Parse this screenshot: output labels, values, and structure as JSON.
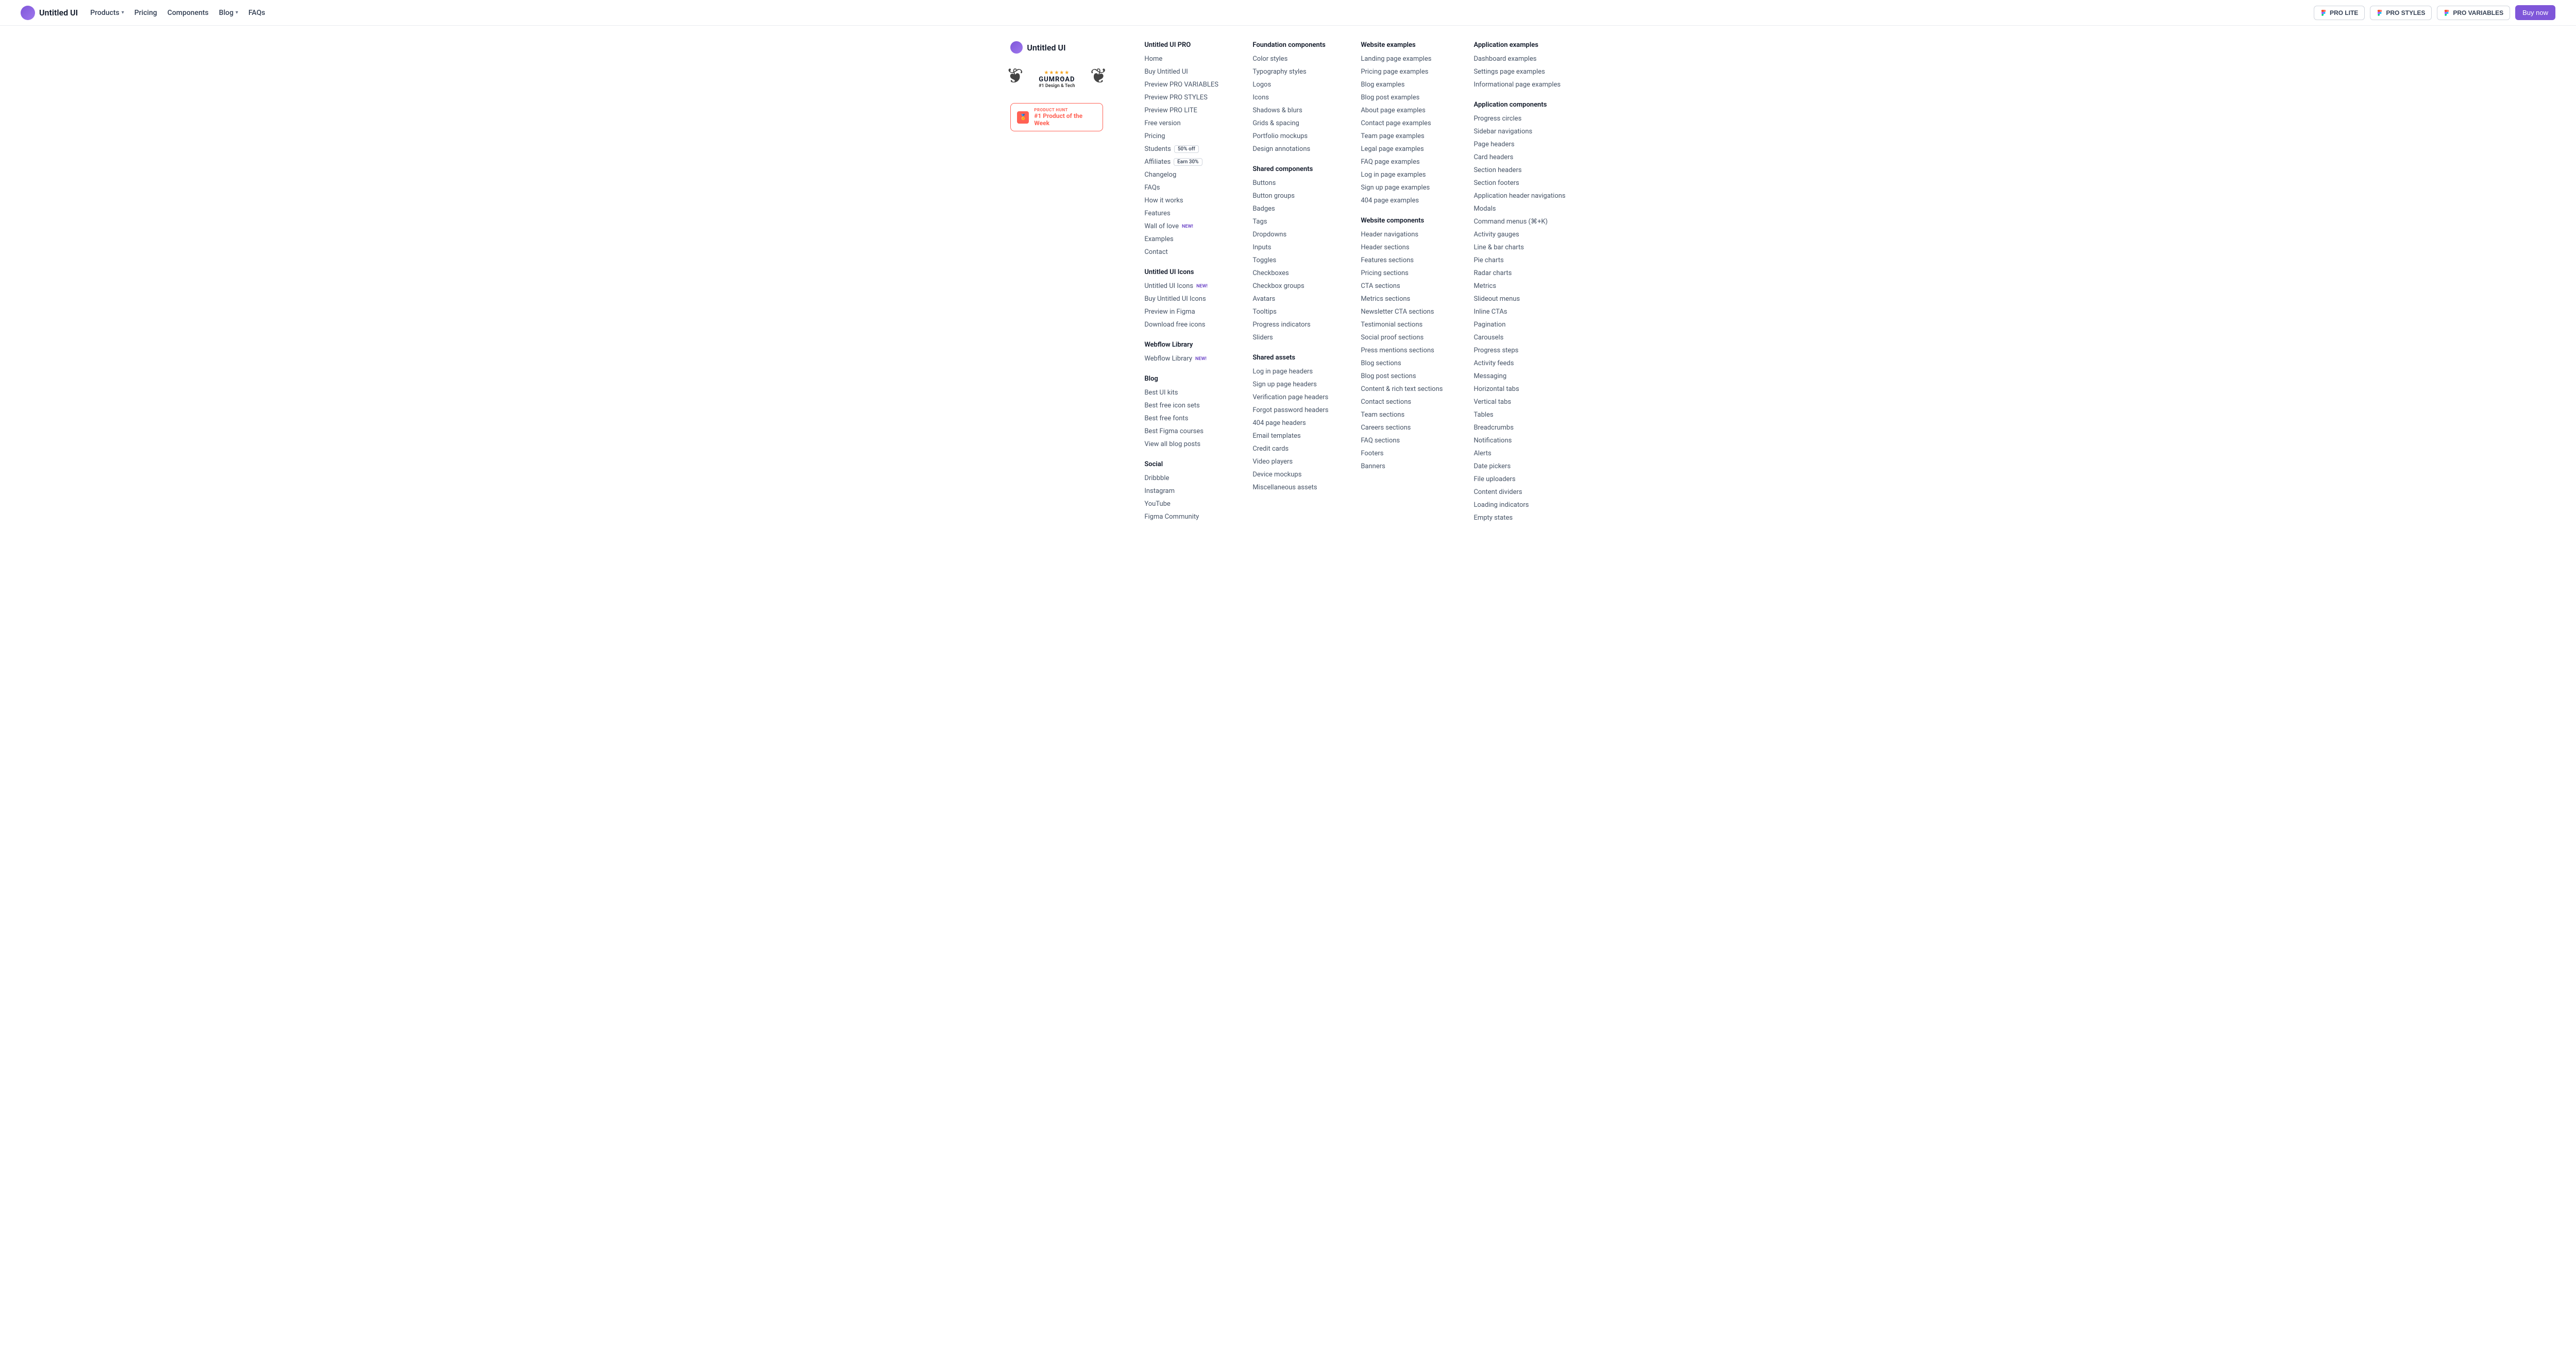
{
  "header": {
    "brand": "Untitled UI",
    "nav": [
      "Products",
      "Pricing",
      "Components",
      "Blog",
      "FAQs"
    ],
    "proLite": "PRO LITE",
    "proStyles": "PRO STYLES",
    "proVariables": "PRO VARIABLES",
    "buy": "Buy now"
  },
  "brandCol": {
    "title": "Untitled UI",
    "laurelBrand": "GUMROAD",
    "laurelSub": "#1 Design & Tech",
    "phTop": "PRODUCT HUNT",
    "phMain": "#1 Product of the Week"
  },
  "badges": {
    "fiftyOff": "50% off",
    "earn30": "Earn 30%",
    "new": "NEW!"
  },
  "columns": [
    {
      "groups": [
        {
          "title": "Untitled UI PRO",
          "links": [
            {
              "t": "Home"
            },
            {
              "t": "Buy Untitled UI"
            },
            {
              "t": "Preview PRO VARIABLES"
            },
            {
              "t": "Preview PRO STYLES"
            },
            {
              "t": "Preview PRO LITE"
            },
            {
              "t": "Free version"
            },
            {
              "t": "Pricing"
            },
            {
              "t": "Students",
              "b": "fiftyOff"
            },
            {
              "t": "Affiliates",
              "b": "earn30"
            },
            {
              "t": "Changelog"
            },
            {
              "t": "FAQs"
            },
            {
              "t": "How it works"
            },
            {
              "t": "Features"
            },
            {
              "t": "Wall of love",
              "b": "new"
            },
            {
              "t": "Examples"
            },
            {
              "t": "Contact"
            }
          ]
        },
        {
          "title": "Untitled UI Icons",
          "links": [
            {
              "t": "Untitled UI Icons",
              "b": "new"
            },
            {
              "t": "Buy Untitled UI Icons"
            },
            {
              "t": "Preview in Figma"
            },
            {
              "t": "Download free icons"
            }
          ]
        },
        {
          "title": "Webflow Library",
          "links": [
            {
              "t": "Webflow Library",
              "b": "new"
            }
          ]
        },
        {
          "title": "Blog",
          "links": [
            {
              "t": "Best UI kits"
            },
            {
              "t": "Best free icon sets"
            },
            {
              "t": "Best free fonts"
            },
            {
              "t": "Best Figma courses"
            },
            {
              "t": "View all blog posts"
            }
          ]
        },
        {
          "title": "Social",
          "links": [
            {
              "t": "Dribbble"
            },
            {
              "t": "Instagram"
            },
            {
              "t": "YouTube"
            },
            {
              "t": "Figma Community"
            }
          ]
        }
      ]
    },
    {
      "groups": [
        {
          "title": "Foundation components",
          "links": [
            {
              "t": "Color styles"
            },
            {
              "t": "Typography styles"
            },
            {
              "t": "Logos"
            },
            {
              "t": "Icons"
            },
            {
              "t": "Shadows & blurs"
            },
            {
              "t": "Grids & spacing"
            },
            {
              "t": "Portfolio mockups"
            },
            {
              "t": "Design annotations"
            }
          ]
        },
        {
          "title": "Shared components",
          "links": [
            {
              "t": "Buttons"
            },
            {
              "t": "Button groups"
            },
            {
              "t": "Badges"
            },
            {
              "t": "Tags"
            },
            {
              "t": "Dropdowns"
            },
            {
              "t": "Inputs"
            },
            {
              "t": "Toggles"
            },
            {
              "t": "Checkboxes"
            },
            {
              "t": "Checkbox groups"
            },
            {
              "t": "Avatars"
            },
            {
              "t": "Tooltips"
            },
            {
              "t": "Progress indicators"
            },
            {
              "t": "Sliders"
            }
          ]
        },
        {
          "title": "Shared assets",
          "links": [
            {
              "t": "Log in page headers"
            },
            {
              "t": "Sign up page headers"
            },
            {
              "t": "Verification page headers"
            },
            {
              "t": "Forgot password headers"
            },
            {
              "t": "404 page headers"
            },
            {
              "t": "Email templates"
            },
            {
              "t": "Credit cards"
            },
            {
              "t": "Video players"
            },
            {
              "t": "Device mockups"
            },
            {
              "t": "Miscellaneous assets"
            }
          ]
        }
      ]
    },
    {
      "groups": [
        {
          "title": "Website examples",
          "links": [
            {
              "t": "Landing page examples"
            },
            {
              "t": "Pricing page examples"
            },
            {
              "t": "Blog examples"
            },
            {
              "t": "Blog post examples"
            },
            {
              "t": "About page examples"
            },
            {
              "t": "Contact page examples"
            },
            {
              "t": "Team page examples"
            },
            {
              "t": "Legal page examples"
            },
            {
              "t": "FAQ page examples"
            },
            {
              "t": "Log in page examples"
            },
            {
              "t": "Sign up page examples"
            },
            {
              "t": "404 page examples"
            }
          ]
        },
        {
          "title": "Website components",
          "links": [
            {
              "t": "Header navigations"
            },
            {
              "t": "Header sections"
            },
            {
              "t": "Features sections"
            },
            {
              "t": "Pricing sections"
            },
            {
              "t": "CTA sections"
            },
            {
              "t": "Metrics sections"
            },
            {
              "t": "Newsletter CTA sections"
            },
            {
              "t": "Testimonial sections"
            },
            {
              "t": "Social proof sections"
            },
            {
              "t": "Press mentions sections"
            },
            {
              "t": "Blog sections"
            },
            {
              "t": "Blog post sections"
            },
            {
              "t": "Content & rich text sections"
            },
            {
              "t": "Contact sections"
            },
            {
              "t": "Team sections"
            },
            {
              "t": "Careers sections"
            },
            {
              "t": "FAQ sections"
            },
            {
              "t": "Footers"
            },
            {
              "t": "Banners"
            }
          ]
        }
      ]
    },
    {
      "groups": [
        {
          "title": "Application examples",
          "links": [
            {
              "t": "Dashboard examples"
            },
            {
              "t": "Settings page examples"
            },
            {
              "t": "Informational page examples"
            }
          ]
        },
        {
          "title": "Application components",
          "links": [
            {
              "t": "Progress circles"
            },
            {
              "t": "Sidebar navigations"
            },
            {
              "t": "Page headers"
            },
            {
              "t": "Card headers"
            },
            {
              "t": "Section headers"
            },
            {
              "t": "Section footers"
            },
            {
              "t": "Application header navigations"
            },
            {
              "t": "Modals"
            },
            {
              "t": "Command menus (⌘+K)"
            },
            {
              "t": "Activity gauges"
            },
            {
              "t": "Line & bar charts"
            },
            {
              "t": "Pie charts"
            },
            {
              "t": "Radar charts"
            },
            {
              "t": "Metrics"
            },
            {
              "t": "Slideout menus"
            },
            {
              "t": "Inline CTAs"
            },
            {
              "t": "Pagination"
            },
            {
              "t": "Carousels"
            },
            {
              "t": "Progress steps"
            },
            {
              "t": "Activity feeds"
            },
            {
              "t": "Messaging"
            },
            {
              "t": "Horizontal tabs"
            },
            {
              "t": "Vertical tabs"
            },
            {
              "t": "Tables"
            },
            {
              "t": "Breadcrumbs"
            },
            {
              "t": "Notifications"
            },
            {
              "t": "Alerts"
            },
            {
              "t": "Date pickers"
            },
            {
              "t": "File uploaders"
            },
            {
              "t": "Content dividers"
            },
            {
              "t": "Loading indicators"
            },
            {
              "t": "Empty states"
            }
          ]
        }
      ]
    }
  ]
}
